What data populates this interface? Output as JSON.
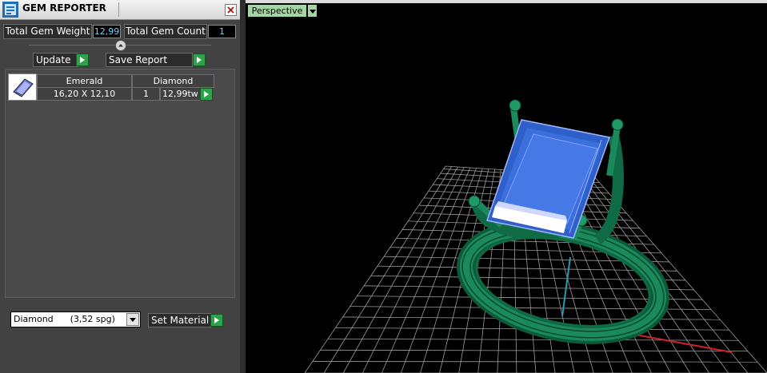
{
  "panel": {
    "title": "GEM REPORTER",
    "total_weight_label": "Total Gem Weight",
    "total_weight_value": "12,99",
    "total_count_label": "Total Gem Count",
    "total_count_value": "1",
    "update_label": "Update",
    "save_report_label": "Save Report"
  },
  "gem_table": {
    "headers": [
      "Emerald",
      "Diamond"
    ],
    "rows": [
      {
        "size": "16,20 X 12,10",
        "count": "1",
        "weight": "12,99tw"
      }
    ]
  },
  "material": {
    "selected": "Diamond      (3,52 spg)",
    "set_label": "Set Material"
  },
  "viewport": {
    "view_name": "Perspective"
  },
  "colors": {
    "gem": "#3a6fd8",
    "metal": "#0f6b46",
    "grid": "#9a9a9a",
    "axis_x": "#cc2222",
    "axis_z": "#22a0b8",
    "accent_button": "#2ea24a"
  },
  "icons": {
    "app": "gem-reporter-app-icon",
    "close": "close-icon",
    "arrow": "play-arrow-icon",
    "gem_thumb": "gem-thumbnail-icon"
  }
}
